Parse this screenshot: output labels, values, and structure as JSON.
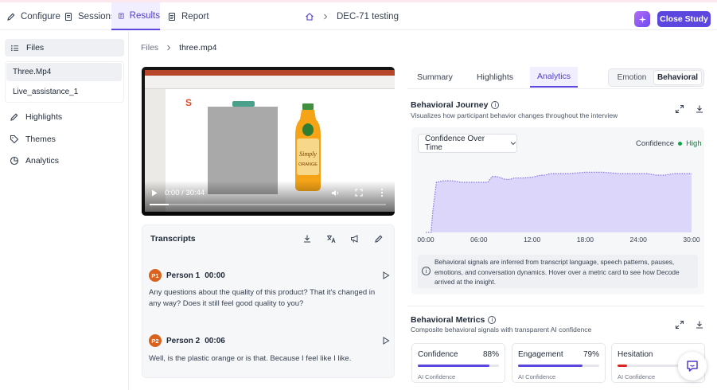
{
  "topbar": {
    "tabs": [
      {
        "label": "Configure"
      },
      {
        "label": "Sessions"
      },
      {
        "label": "Results"
      },
      {
        "label": "Report"
      }
    ],
    "breadcrumb": "DEC-71 testing",
    "close_label": "Close Study"
  },
  "sidebar": {
    "files_label": "Files",
    "files": [
      "Three.Mp4",
      "Live_assistance_1"
    ],
    "nav": [
      {
        "label": "Highlights",
        "icon": "pen-icon"
      },
      {
        "label": "Themes",
        "icon": "tag-icon"
      },
      {
        "label": "Analytics",
        "icon": "pie-chart-icon"
      }
    ]
  },
  "content": {
    "breadcrumb_root": "Files",
    "breadcrumb_current": "three.mp4"
  },
  "video": {
    "time": "0:00 / 30:44",
    "progress": 0.08,
    "slide_logo": "S"
  },
  "transcripts": {
    "title": "Transcripts",
    "entries": [
      {
        "badge": "P1",
        "speaker": "Person 1",
        "time": "00:00",
        "text": "Any questions about the quality of this product? That it's changed in any way? Does it still feel good quality to you?"
      },
      {
        "badge": "P2",
        "speaker": "Person 2",
        "time": "00:06",
        "text": "Well, is the plastic orange or is that. Because I feel like I like."
      }
    ]
  },
  "analytics": {
    "tabs": [
      "Summary",
      "Highlights",
      "Analytics"
    ],
    "active_tab": "Analytics",
    "mode": [
      "Emotion",
      "Behavioral"
    ],
    "active_mode": "Behavioral",
    "journey_title": "Behavioral Journey",
    "journey_sub": "Visualizes how participant behavior changes throughout the interview",
    "dropdown": "Confidence Over Time",
    "legend_label": "Confidence",
    "legend_level": "High",
    "note": "Behavioral signals are inferred from transcript language, speech patterns, pauses, emotions, and conversation dynamics. Hover over a metric card to see how Decode arrived at the insight.",
    "metrics_title": "Behavioral Metrics",
    "metrics_sub": "Composite behavioral signals with transparent AI confidence",
    "metrics": [
      {
        "name": "Confidence",
        "value": "88%",
        "level": 0.88,
        "color": "#5b46e0",
        "sub": "AI Confidence"
      },
      {
        "name": "Engagement",
        "value": "79%",
        "level": 0.79,
        "color": "#5b46e0",
        "sub": "AI Confidence"
      },
      {
        "name": "Hesitation",
        "value": "",
        "level": 0.12,
        "color": "#dc2626",
        "sub": "AI Confidence"
      }
    ]
  },
  "chart_data": {
    "type": "area",
    "x_ticks": [
      "00:00",
      "06:00",
      "12:00",
      "18:00",
      "24:00",
      "30:00"
    ],
    "xlim": [
      0,
      30
    ],
    "ylim": [
      0,
      100
    ],
    "series": [
      {
        "x": [
          0,
          0.6,
          0.8,
          1.2,
          2,
          3,
          4,
          5,
          6,
          7,
          7.5,
          8,
          9,
          9.5,
          10,
          11,
          12,
          13,
          13.5,
          14,
          15,
          16,
          17,
          18,
          19,
          20,
          21,
          22,
          23,
          24,
          25,
          26,
          27,
          28,
          29,
          30
        ],
        "y": [
          0,
          0,
          30,
          70,
          72,
          72,
          70,
          70,
          70,
          70,
          78,
          78,
          74,
          74,
          76,
          76,
          77,
          80,
          80,
          82,
          82,
          82,
          83,
          84,
          84,
          84,
          83,
          82,
          82,
          82,
          82,
          80,
          80,
          82,
          82,
          82
        ]
      }
    ],
    "grid": false
  }
}
